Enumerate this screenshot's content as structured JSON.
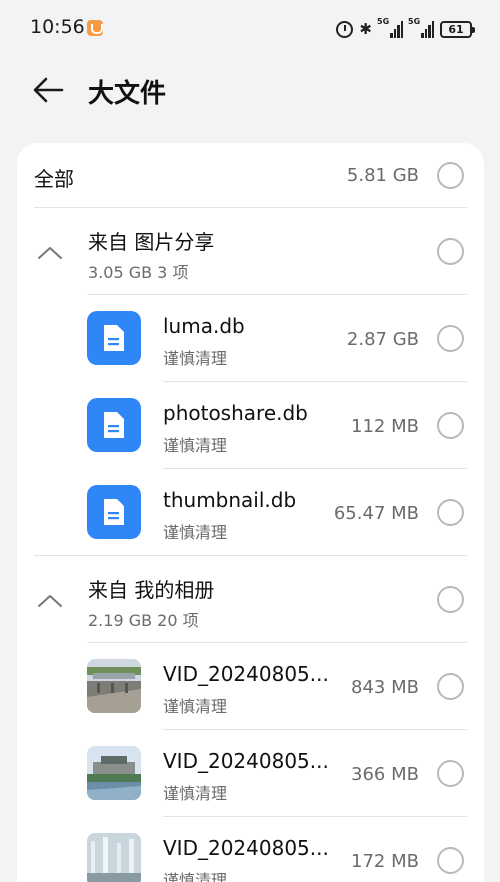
{
  "status_bar": {
    "time": "10:56",
    "signal_1": "5G",
    "signal_2": "5G",
    "battery": "61"
  },
  "header": {
    "title": "大文件"
  },
  "all_row": {
    "label": "全部",
    "size": "5.81 GB"
  },
  "groups": [
    {
      "title": "来自 图片分享",
      "meta": "3.05 GB 3 项",
      "items": [
        {
          "name": "luma.db",
          "note": "谨慎清理",
          "size": "2.87 GB",
          "icon": "file-doc-icon"
        },
        {
          "name": "photoshare.db",
          "note": "谨慎清理",
          "size": "112 MB",
          "icon": "file-doc-icon"
        },
        {
          "name": "thumbnail.db",
          "note": "谨慎清理",
          "size": "65.47 MB",
          "icon": "file-doc-icon"
        }
      ]
    },
    {
      "title": "来自 我的相册",
      "meta": "2.19 GB 20 项",
      "items": [
        {
          "name": "VID_20240805...",
          "note": "谨慎清理",
          "size": "843 MB",
          "icon": "video-thumbnail"
        },
        {
          "name": "VID_20240805...",
          "note": "谨慎清理",
          "size": "366 MB",
          "icon": "video-thumbnail"
        },
        {
          "name": "VID_20240805...",
          "note": "谨慎清理",
          "size": "172 MB",
          "icon": "video-thumbnail"
        }
      ]
    }
  ],
  "colors": {
    "accent": "#2f86f6",
    "background": "#f1f3f5",
    "card": "#ffffff",
    "secondary_text": "#6b6b6b"
  }
}
